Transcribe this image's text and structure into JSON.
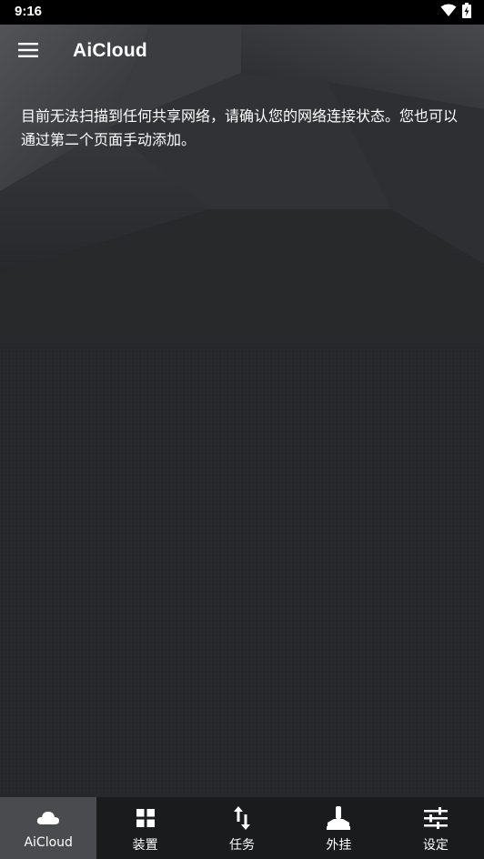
{
  "status_bar": {
    "time": "9:16",
    "icons": [
      "wifi-icon",
      "battery-charging-icon"
    ]
  },
  "app_bar": {
    "menu_icon": "hamburger-menu-icon",
    "title": "AiCloud"
  },
  "main": {
    "message": "目前无法扫描到任何共享网络，请确认您的网络连接状态。您也可以通过第二个页面手动添加。"
  },
  "bottom_nav": {
    "items": [
      {
        "label": "AiCloud",
        "icon": "cloud-icon",
        "active": true
      },
      {
        "label": "装置",
        "icon": "grid-icon",
        "active": false
      },
      {
        "label": "任务",
        "icon": "transfer-arrows-icon",
        "active": false
      },
      {
        "label": "外挂",
        "icon": "joystick-icon",
        "active": false
      },
      {
        "label": "设定",
        "icon": "sliders-icon",
        "active": false
      }
    ]
  },
  "colors": {
    "background": "#26282b",
    "status_bar": "#000000",
    "bottom_nav": "#1a1b1d",
    "nav_active": "#4a4b4e",
    "text": "#ffffff"
  }
}
